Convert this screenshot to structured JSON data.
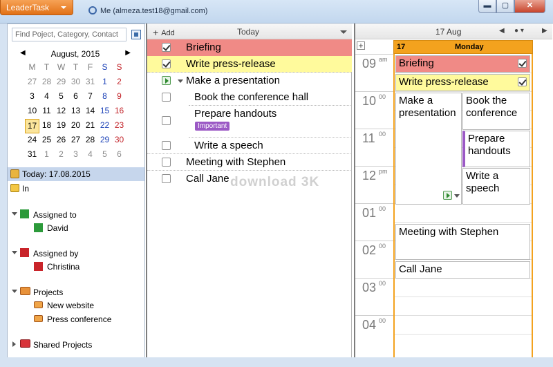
{
  "app": {
    "menu_label": "LeaderTask",
    "account": "Me (almeza.test18@gmail.com)",
    "window_min": "▬",
    "window_max": "▢",
    "window_close": "✕"
  },
  "colors": {
    "accent": "#e7771f",
    "selection": "#c6d6ec",
    "task_red": "#f08a86",
    "task_yellow": "#fffa9c",
    "badge_purple": "#9b59c5",
    "day_header": "#f3a21e"
  },
  "sidebar": {
    "search_placeholder": "Find Poject, Category, Contact",
    "calendar": {
      "month_label": "August, 2015",
      "prev": "◀",
      "next": "▶",
      "weekdays": [
        "M",
        "T",
        "W",
        "T",
        "F",
        "S",
        "S"
      ],
      "weeks": [
        [
          "27",
          "28",
          "29",
          "30",
          "31",
          "1",
          "2"
        ],
        [
          "3",
          "4",
          "5",
          "6",
          "7",
          "8",
          "9"
        ],
        [
          "10",
          "11",
          "12",
          "13",
          "14",
          "15",
          "16"
        ],
        [
          "17",
          "18",
          "19",
          "20",
          "21",
          "22",
          "23"
        ],
        [
          "24",
          "25",
          "26",
          "27",
          "28",
          "29",
          "30"
        ],
        [
          "31",
          "1",
          "2",
          "3",
          "4",
          "5",
          "6"
        ]
      ],
      "today": "17"
    },
    "today_item": "Today: 17.08.2015",
    "in_item": "In",
    "assigned_to": {
      "label": "Assigned to",
      "person": "David"
    },
    "assigned_by": {
      "label": "Assigned by",
      "person": "Christina"
    },
    "projects": {
      "label": "Projects",
      "items": [
        "New website",
        "Press conference"
      ]
    },
    "shared_projects": "Shared Projects"
  },
  "middle": {
    "add_label": "Add",
    "title": "Today",
    "tasks": [
      {
        "label": "Briefing",
        "checked": true
      },
      {
        "label": "Write press-release",
        "checked": true
      },
      {
        "label": "Make a presentation",
        "checked": false
      },
      {
        "label": "Book the conference hall",
        "checked": false
      },
      {
        "label": "Prepare handouts",
        "checked": false,
        "badge": "Important"
      },
      {
        "label": "Write a speech",
        "checked": false
      },
      {
        "label": "Meeting with Stephen",
        "checked": false
      },
      {
        "label": "Call Jane",
        "checked": false
      }
    ],
    "watermark": "download 3K"
  },
  "right": {
    "date_label": "17 Aug",
    "day_number": "17",
    "day_name": "Monday",
    "hours": [
      {
        "h": "09",
        "ap": "am"
      },
      {
        "h": "10",
        "ap": "00"
      },
      {
        "h": "11",
        "ap": "00"
      },
      {
        "h": "12",
        "ap": "pm"
      },
      {
        "h": "01",
        "ap": "00"
      },
      {
        "h": "02",
        "ap": "00"
      },
      {
        "h": "03",
        "ap": "00"
      },
      {
        "h": "04",
        "ap": "00"
      }
    ],
    "events": {
      "briefing": "Briefing",
      "press_release": "Write press-release",
      "presentation": "Make a presentation",
      "book_conf": "Book the conference",
      "handouts": "Prepare handouts",
      "speech": "Write a speech",
      "meeting": "Meeting with Stephen",
      "call": "Call Jane"
    }
  }
}
